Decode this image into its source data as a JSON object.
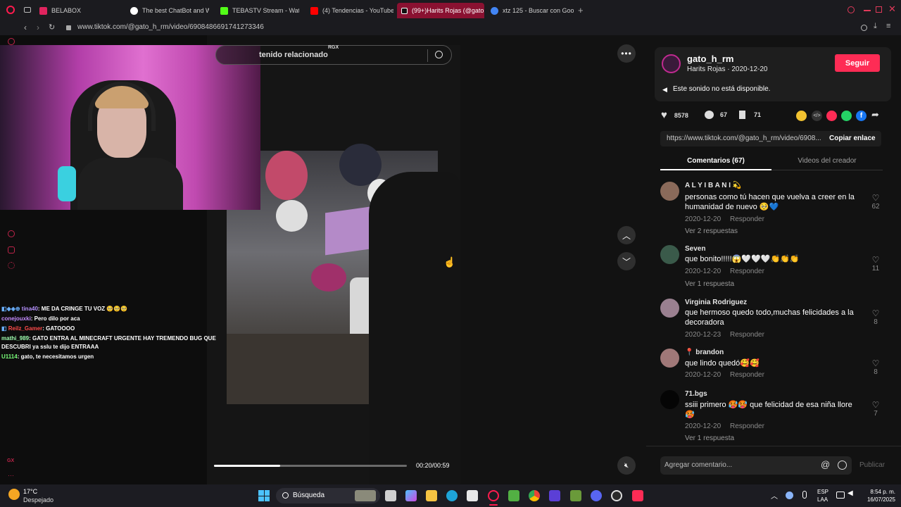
{
  "browser": {
    "tabs": [
      {
        "label": "BELABOX",
        "color": "#e0245e"
      },
      {
        "label": "The best ChatBot and Wi",
        "color": "#ffffff"
      },
      {
        "label": "TEBASTV Stream - Watch",
        "color": "#53fc18"
      },
      {
        "label": "(4) Tendencias - YouTube",
        "color": "#ff0000"
      },
      {
        "label": "(99+)Harits Rojas (@gato",
        "color": "#ffffff"
      },
      {
        "label": "xtz 125 - Buscar con Goo",
        "color": "#4285f4"
      }
    ],
    "url": "www.tiktok.com/@gato_h_rm/video/6908486691741273346"
  },
  "stream": {
    "chat": [
      {
        "user": "tina40",
        "text": ": ME DA CRINGE TU VOZ 🥺🥺🥺",
        "color": "#b692ff"
      },
      {
        "user": "conejouxki",
        "text": ": Pero dilo por aca",
        "color": "#c58cff"
      },
      {
        "user": "Reilz_Gamer",
        "text": ": GATOOOO",
        "color": "#ff4a4a"
      },
      {
        "user": "mathi_989",
        "text": ": GATO ENTRA AL MINECRAFT URGENTE HAY TREMENDO BUG QUE",
        "color": "#a0ffb0"
      },
      {
        "user": "",
        "text": "DESCUBRI ya sslu te dijo ENTRAAA",
        "color": "#ffffff"
      },
      {
        "user": "U1114",
        "text": ": gato, te necesitamos urgen",
        "color": "#7aff7a"
      }
    ],
    "gx_label": "GX"
  },
  "video": {
    "search_placeholder": "tenido relacionado",
    "rgx_badge": "RGX",
    "time": "00:20/00:59",
    "progress": 0.344
  },
  "author": {
    "username": "gato_h_rm",
    "display": "Harits Rojas · 2020-12-20",
    "follow_label": "Seguir",
    "sound": "Este sonido no está disponible.",
    "likes": "8578",
    "comments": "67",
    "saves": "71",
    "link": "https://www.tiktok.com/@gato_h_rm/video/6908...",
    "copy_label": "Copiar enlace",
    "tab_comments": "Comentarios (67)",
    "tab_videos": "Videos del creador"
  },
  "comments": [
    {
      "name": "A L Y I B A N I 💫",
      "text": "personas como tú hacen que vuelva a creer en la humanidad de nuevo 🥺💙",
      "date": "2020-12-20",
      "reply": "Responder",
      "more": "Ver 2 respuestas",
      "likes": "62",
      "avatar": "#8a6a5a"
    },
    {
      "name": "Seven",
      "text": "que bonito!!!!!😱🤍🤍🤍👏👏👏",
      "date": "2020-12-20",
      "reply": "Responder",
      "more": "Ver 1 respuesta",
      "likes": "11",
      "avatar": "#3a5a4a"
    },
    {
      "name": "Virginia Rodriguez",
      "text": "que hermoso quedo todo,muchas felicidades a la decoradora",
      "date": "2020-12-23",
      "reply": "Responder",
      "more": "",
      "likes": "8",
      "avatar": "#9a8090"
    },
    {
      "name": "📍 brandon",
      "text": "que lindo quedó🥰🥰",
      "date": "2020-12-20",
      "reply": "Responder",
      "more": "",
      "likes": "8",
      "avatar": "#a07878"
    },
    {
      "name": "71.bgs",
      "text": "ssiii primero 🥵🥵 que felicidad de esa niña llore 🥵",
      "date": "2020-12-20",
      "reply": "Responder",
      "more": "Ver 1 respuesta",
      "likes": "7",
      "avatar": "#050505"
    }
  ],
  "comment_input": {
    "placeholder": "Agregar comentario...",
    "post_label": "Publicar"
  },
  "taskbar": {
    "weather_temp": "17°C",
    "weather_desc": "Despejado",
    "search": "Búsqueda",
    "lang1": "ESP",
    "lang2": "LAA",
    "time": "8:54 p. m.",
    "date": "16/07/2025"
  }
}
